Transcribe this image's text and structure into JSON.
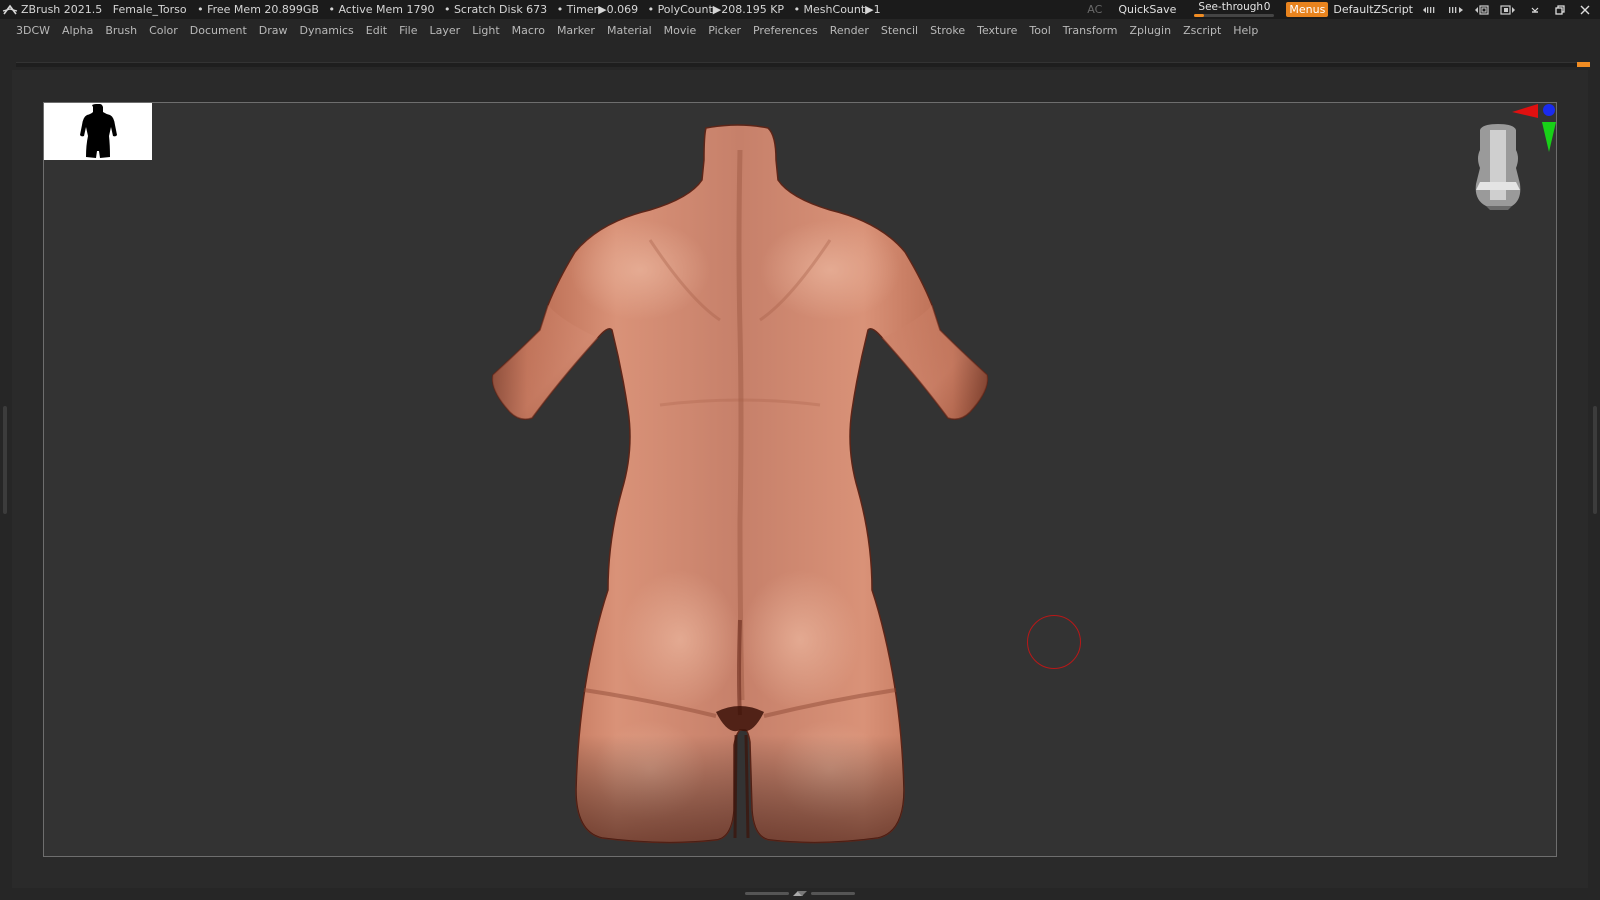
{
  "titlebar": {
    "app": "ZBrush 2021.5",
    "doc": "Female_Torso",
    "free_mem": "• Free Mem 20.899GB",
    "active_mem": "• Active Mem 1790",
    "scratch": "• Scratch Disk 673",
    "timer": "• Timer▶0.069",
    "polycount": "• PolyCount▶208.195 KP",
    "meshcount": "• MeshCount▶1",
    "ac": "AC",
    "quicksave": "QuickSave",
    "seethrough_label": "See-through",
    "seethrough_value": "0",
    "seethrough_level": 0.12,
    "menus": "Menus",
    "script": "DefaultZScript"
  },
  "menu": [
    "3DCW",
    "Alpha",
    "Brush",
    "Color",
    "Document",
    "Draw",
    "Dynamics",
    "Edit",
    "File",
    "Layer",
    "Light",
    "Macro",
    "Marker",
    "Material",
    "Movie",
    "Picker",
    "Preferences",
    "Render",
    "Stencil",
    "Stroke",
    "Texture",
    "Tool",
    "Transform",
    "Zplugin",
    "Zscript",
    "Help"
  ],
  "colors": {
    "accent": "#f08c23",
    "skin_light": "#e4a890",
    "skin_mid": "#c98064",
    "skin_dark": "#5a2a1e",
    "cursor": "#b81818"
  },
  "icons": {
    "logo": "zbrush-logo-icon",
    "gizmo": "navigation-gizmo-icon"
  }
}
